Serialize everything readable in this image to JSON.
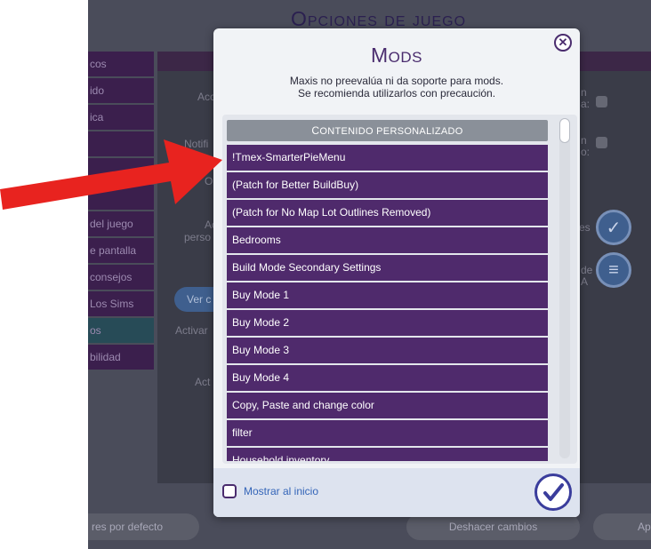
{
  "background": {
    "title": "Opciones de juego",
    "categories": [
      {
        "label": "cos"
      },
      {
        "label": "ido"
      },
      {
        "label": "ica"
      },
      {
        "label": ""
      },
      {
        "label": ""
      },
      {
        "label": ""
      },
      {
        "label": "del juego"
      },
      {
        "label": "e pantalla"
      },
      {
        "label": "consejos"
      },
      {
        "label": " Los Sims"
      },
      {
        "label": "os"
      },
      {
        "label": "bilidad"
      }
    ],
    "labels": {
      "acc": "Acc",
      "notif": "Notifi",
      "o": "O",
      "ac": "Ac",
      "perso": "perso",
      "activar": "Activar",
      "act": "Act",
      "right_n1": "n",
      "right_a1": "a:",
      "right_n2": "n",
      "right_o2": "o:",
      "right_es": "es",
      "right_de": "de",
      "right_a3": "A"
    },
    "ver_button": "Ver c",
    "defaults_button": "res por defecto",
    "undo_button": "Deshacer cambios",
    "apply_button": "Ap"
  },
  "modal": {
    "title_cap": "M",
    "title_rest": "ODS",
    "warning_line1": "Maxis no preevalúa ni da soporte para mods.",
    "warning_line2": "Se recomienda utilizarlos con precaución.",
    "list_header_cap": "C",
    "list_header_rest": "ONTENIDO PERSONALIZADO",
    "mods": [
      "!Tmex-SmarterPieMenu",
      "(Patch for Better BuildBuy)",
      "(Patch for No Map Lot Outlines Removed)",
      "Bedrooms",
      "Build Mode Secondary Settings",
      "Buy Mode 1",
      "Buy Mode 2",
      "Buy Mode 3",
      "Buy Mode 4",
      "Copy, Paste and change color",
      "filter",
      "Household inventory"
    ],
    "show_at_start_label": "Mostrar al inicio",
    "show_at_start_checked": false,
    "close_icon": "close-icon",
    "confirm_icon": "checkmark-icon"
  },
  "colors": {
    "mod_row": "#4f2a6c",
    "accent_purple": "#4a2c6e",
    "link_blue": "#3465b8",
    "arrow_red": "#e8231f"
  }
}
